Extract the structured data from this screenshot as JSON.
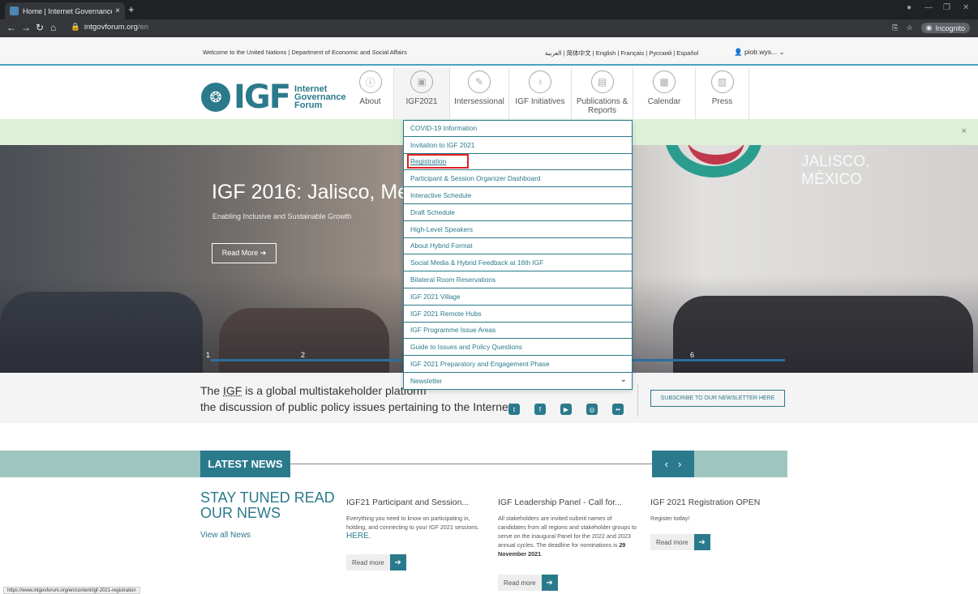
{
  "browser": {
    "tab_title": "Home | Internet Governance Foru",
    "tab_close": "×",
    "new_tab": "+",
    "url_host": "intgovforum.org",
    "url_path": "/en",
    "incognito_label": "Incognito",
    "status_url": "https://www.intgovforum.org/en/content/igf-2021-registration"
  },
  "un_bar": {
    "welcome": "Welcome to the United Nations",
    "separator": "|",
    "department": "Department of Economic and Social Affairs",
    "languages": "العربية | 简体中文 | English | Français | Русский | Español",
    "user": "piotr.wys..."
  },
  "logo": {
    "igf": "IGF",
    "line1": "Internet",
    "line2": "Governance",
    "line3": "Forum"
  },
  "nav": {
    "items": [
      {
        "label": "About",
        "icon": "info-icon"
      },
      {
        "label": "IGF2021",
        "icon": "calendar-icon"
      },
      {
        "label": "Intersessional",
        "icon": "pen-icon"
      },
      {
        "label": "IGF Initiatives",
        "icon": "bulb-icon"
      },
      {
        "label": "Publications & Reports",
        "icon": "document-icon"
      },
      {
        "label": "Calendar",
        "icon": "calendar-grid-icon"
      },
      {
        "label": "Press",
        "icon": "press-icon"
      }
    ]
  },
  "notice": {
    "close": "×"
  },
  "hero": {
    "title": "IGF 2016: Jalisco, Me",
    "subtitle": "Enabling Inclusive and Sustainable Growth",
    "button": "Read More ➔",
    "right_line1": "JALISCO,",
    "right_line2": "MÉXICO",
    "slide_1": "1",
    "slide_2": "2",
    "slide_6": "6"
  },
  "dropdown": {
    "items": [
      "COVID-19 Information",
      "Invitation to IGF 2021",
      "Registration",
      "Participant & Session Organizer Dashboard",
      "Interactive Schedule",
      "Draft Schedule",
      "High-Level Speakers",
      "About Hybrid Format",
      "Social Media & Hybrid Feedback at 16th IGF",
      "Bilateral Room Reservations",
      "IGF 2021 Village",
      "IGF 2021 Remote Hubs",
      "IGF Programme Issue Areas",
      "Guide to Issues and Policy Questions",
      "IGF 2021 Preparatory and Engagement Phase",
      "Newsletter"
    ]
  },
  "intro": {
    "pre": "The ",
    "igf": "IGF",
    "line1_rest": " is a global multistakeholder platform",
    "line2": "the discussion of public policy issues pertaining to the Internet",
    "subscribe": "SUBSCRIBE TO OUR NEWSLETTER HERE"
  },
  "news": {
    "section_title": "LATEST NEWS",
    "stay_tuned": "STAY TUNED READ OUR NEWS",
    "view_all": "View all News",
    "cards": [
      {
        "title": "IGF21 Participant and Session...",
        "body": "Everything you need to know on participating in, holding, and connecting to your IGF 2021 sessions.",
        "highlight": "HERE.",
        "read_more": "Read more"
      },
      {
        "title": "IGF Leadership Panel - Call for...",
        "body": "All stakeholders are invited submit names of candidates from all regions and stakeholder groups to serve on the inaugural Panel for the 2022 and 2023 annual cycles. The deadline for nominations is",
        "bold": "29 November 2021",
        "read_more": "Read more"
      },
      {
        "title": "IGF 2021 Registration OPEN",
        "body": "Register today!",
        "read_more": "Read more"
      }
    ]
  },
  "colors": {
    "brand": "#2a7a8c",
    "highlight_box": "#e02020",
    "notice": "#dff0d8"
  }
}
